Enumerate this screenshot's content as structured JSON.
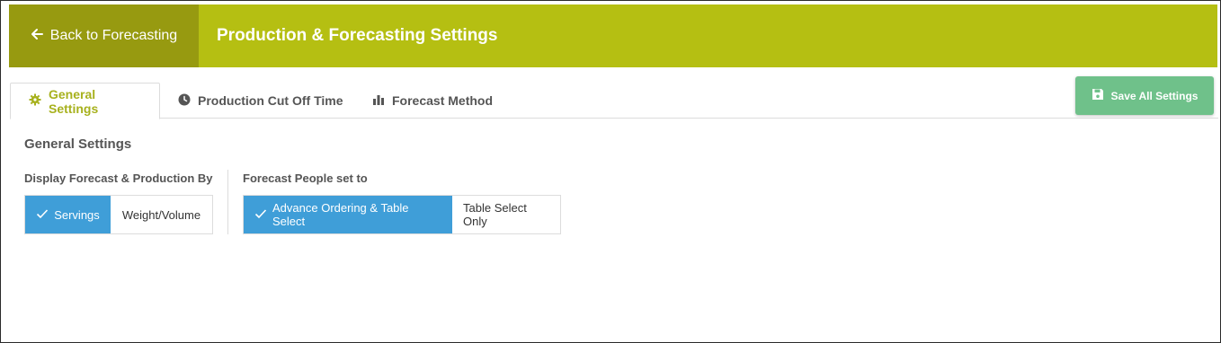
{
  "header": {
    "back_label": "Back to Forecasting",
    "title": "Production & Forecasting Settings",
    "colors": {
      "bar": "#b5bf12",
      "back_bg": "#979a10"
    }
  },
  "tabs": [
    {
      "label": "General Settings",
      "icon": "gear-icon",
      "active": true
    },
    {
      "label": "Production Cut Off Time",
      "icon": "clock-icon",
      "active": false
    },
    {
      "label": "Forecast Method",
      "icon": "bar-chart-icon",
      "active": false
    }
  ],
  "save_button": {
    "label": "Save All Settings",
    "icon": "save-icon",
    "color": "#6fc18a"
  },
  "section": {
    "title": "General Settings",
    "display_group": {
      "label": "Display Forecast & Production By",
      "options": [
        {
          "label": "Servings",
          "selected": true
        },
        {
          "label": "Weight/Volume",
          "selected": false
        }
      ]
    },
    "people_group": {
      "label": "Forecast People set to",
      "options": [
        {
          "label": "Advance Ordering & Table Select",
          "selected": true
        },
        {
          "label": "Table Select Only",
          "selected": false
        }
      ]
    },
    "selected_color": "#3f9ed8"
  }
}
